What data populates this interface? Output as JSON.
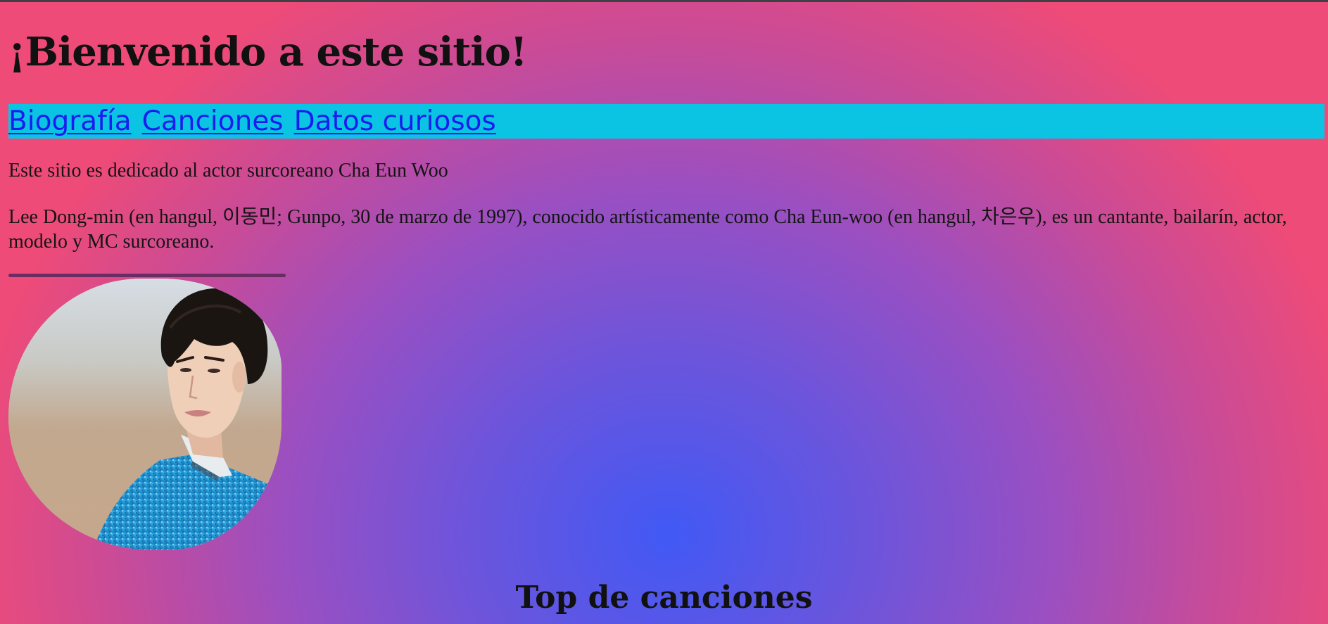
{
  "header": {
    "title": "¡Bienvenido a este sitio!"
  },
  "nav": {
    "links": [
      {
        "label": "Biografía"
      },
      {
        "label": "Canciones"
      },
      {
        "label": "Datos curiosos"
      }
    ]
  },
  "main": {
    "intro": "Este sitio es dedicado al actor surcoreano Cha Eun Woo",
    "bio": "Lee Dong-min (en hangul, 이동민; Gunpo, 30 de marzo de 1997), conocido artísticamente como Cha Eun-woo (en hangul, 차은우), es un cantante, bailarín, actor, modelo y MC surcoreano.",
    "songs_heading": "Top de canciones"
  },
  "colors": {
    "nav_background": "#0bc4e3",
    "link": "#1c1cf0",
    "divider": "#6a2d63",
    "gradient_center": "#4159f5",
    "gradient_edge": "#ee4b78"
  }
}
